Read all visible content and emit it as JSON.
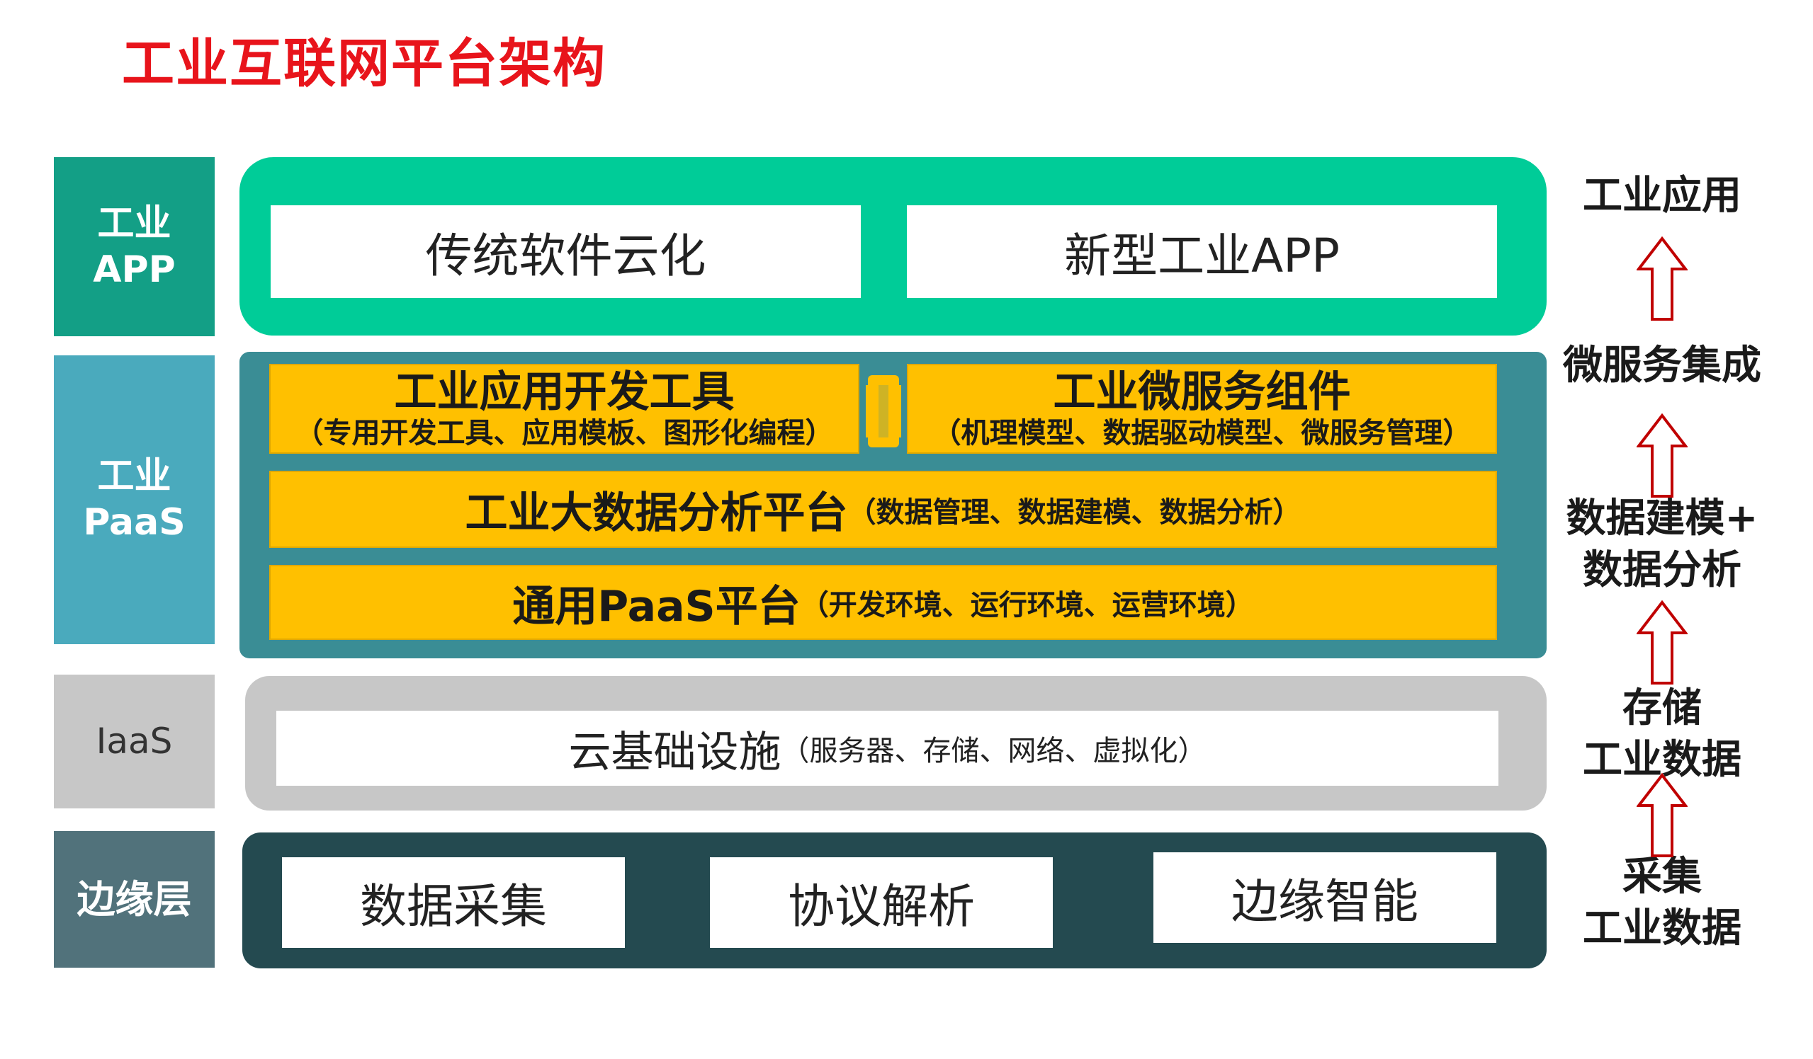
{
  "title": "工业互联网平台架构",
  "side_labels": {
    "app": [
      "工业",
      "APP"
    ],
    "paas": [
      "工业",
      "PaaS"
    ],
    "iaas": "IaaS",
    "edge": "边缘层"
  },
  "app_layer": {
    "items": [
      "传统软件云化",
      "新型工业APP"
    ]
  },
  "paas_layer": {
    "dev_tools": {
      "title": "工业应用开发工具",
      "detail": "（专用开发工具、应用模板、图形化编程）"
    },
    "microservices": {
      "title": "工业微服务组件",
      "detail": "（机理模型、数据驱动模型、微服务管理）"
    },
    "big_data": {
      "title": "工业大数据分析平台",
      "detail": "（数据管理、数据建模、数据分析）"
    },
    "general_paas": {
      "title": "通用PaaS平台",
      "detail": "（开发环境、运行环境、运营环境）"
    }
  },
  "iaas_layer": {
    "title": "云基础设施",
    "detail": "（服务器、存储、网络、虚拟化）"
  },
  "edge_layer": {
    "items": [
      "数据采集",
      "协议解析",
      "边缘智能"
    ]
  },
  "right_labels": {
    "l1": [
      "工业应用"
    ],
    "l2": [
      "微服务集成"
    ],
    "l3": [
      "数据建模+",
      "数据分析"
    ],
    "l4": [
      "存储",
      "工业数据"
    ],
    "l5": [
      "采集",
      "工业数据"
    ]
  },
  "colors": {
    "title": "#e8141b",
    "app_green": "#00cc98",
    "paas_teal": "#3a8d95",
    "iaas_gray": "#c7c7c7",
    "edge_dark": "#244a50",
    "yellow": "#ffc000",
    "arrow_red": "#c00000"
  },
  "icons": {
    "arrow": "up-arrow-icon",
    "connector": "connector-icon"
  }
}
